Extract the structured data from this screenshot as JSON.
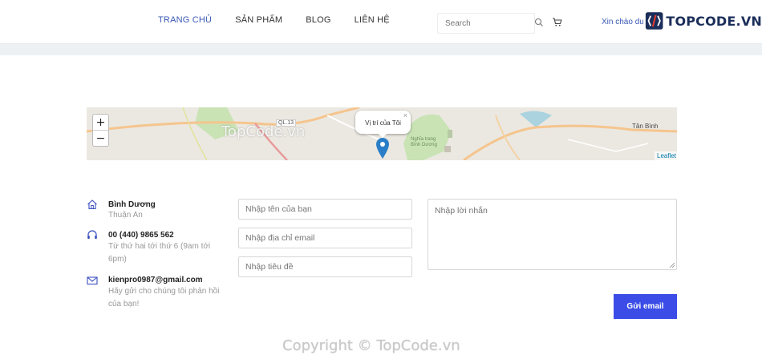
{
  "nav": {
    "items": [
      {
        "label": "TRANG CHỦ",
        "active": true
      },
      {
        "label": "SẢN PHẨM",
        "active": false
      },
      {
        "label": "BLOG",
        "active": false
      },
      {
        "label": "LIÊN HỆ",
        "active": false
      }
    ]
  },
  "search": {
    "placeholder": "Search"
  },
  "header": {
    "greeting": "Xin chào du",
    "logo_text": "TOPCODE.VN"
  },
  "map": {
    "zoom_in": "+",
    "zoom_out": "−",
    "popup_text": "Vị trí của Tôi",
    "popup_close": "×",
    "attribution": "Leaflet",
    "watermark": "TopCode.vn",
    "labels": {
      "road": "QL.13",
      "cemetery": "Nghĩa trang Bình Dương",
      "district": "Tân Bình"
    }
  },
  "contact": {
    "address_title": "Bình Dương",
    "address_sub": "Thuận An",
    "phone_title": "00 (440) 9865 562",
    "phone_sub_1": "Từ thứ hai tới thứ 6 (9am tới",
    "phone_sub_2": "6pm)",
    "email_title": "kienpro0987@gmail.com",
    "email_sub_1": "Hãy gửi cho chúng tôi phản hồi",
    "email_sub_2": "của bạn!"
  },
  "form": {
    "name_placeholder": "Nhập tên của bạn",
    "email_placeholder": "Nhập địa chỉ email",
    "subject_placeholder": "Nhập tiêu đề",
    "message_placeholder": "Nhập lời nhắn",
    "submit_label": "Gửi email"
  },
  "footer": {
    "copyright": "Copyright © TopCode.vn"
  },
  "colors": {
    "accent": "#3a59b6",
    "button": "#3b4de6"
  }
}
